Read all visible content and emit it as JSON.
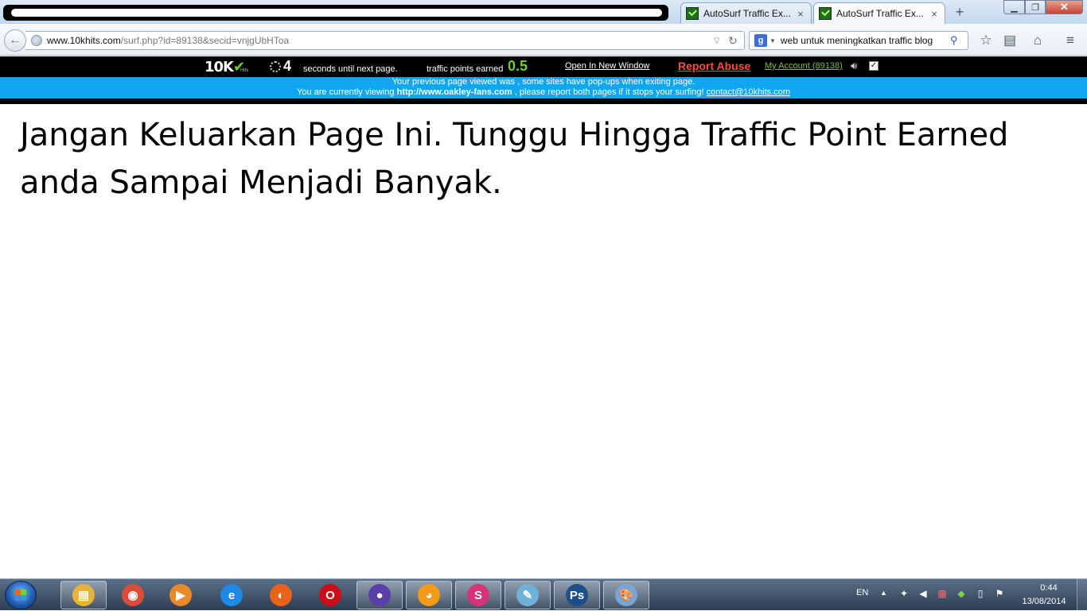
{
  "browser": {
    "tabs": [
      {
        "label": "AutoSurf Traffic Ex...",
        "close": "×"
      },
      {
        "label": "AutoSurf Traffic Ex...",
        "close": "×"
      }
    ],
    "new_tab": "+",
    "window_controls": {
      "minimize": "▁",
      "maximize": "❐",
      "close": "✕"
    },
    "nav": {
      "url_domain": "www.10khits.com",
      "url_path": "/surf.php?id=89138&secid=vnjgUbHToa",
      "search_engine": "g",
      "search_query": "web untuk meningkatkan traffic blog",
      "icons": {
        "back": "back-arrow-icon",
        "star": "star-icon",
        "reader": "reading-list-icon",
        "home": "home-icon",
        "menu": "menu-icon"
      }
    }
  },
  "surfbar": {
    "logo": "10K",
    "logo_check": "✔",
    "logo_sub": "Hits",
    "countdown": "4",
    "countdown_label": "seconds until next page.",
    "points_label": "traffic points earned",
    "points_value": "0.5",
    "open_new_window": "Open In New Window",
    "report_abuse": "Report Abuse",
    "my_account": "My Account (89138)",
    "checkbox": "✓"
  },
  "infobar": {
    "line1": "Your previous page viewed was , some sites have pop-ups when exiting page.",
    "line2_prefix": "You are currently viewing",
    "line2_url": "http://www.oakley-fans.com",
    "line2_middle": ", please report both pages if it stops your surfing!",
    "line2_email": "contact@10khits.com"
  },
  "page": {
    "heading": "Jangan Keluarkan Page Ini. Tunggu Hingga Traffic Point Earned anda Sampai Menjadi Banyak."
  },
  "taskbar": {
    "apps": [
      {
        "name": "windows-explorer",
        "glyph": "▤",
        "color": "#e8b33a"
      },
      {
        "name": "chrome",
        "glyph": "◉",
        "color": "#dd4b39"
      },
      {
        "name": "media-player",
        "glyph": "▶",
        "color": "#e88a2a"
      },
      {
        "name": "internet-explorer",
        "glyph": "e",
        "color": "#1e88e5"
      },
      {
        "name": "firefox",
        "glyph": "◐",
        "color": "#e8641c"
      },
      {
        "name": "opera",
        "glyph": "O",
        "color": "#cc0f16"
      },
      {
        "name": "firefox-active",
        "glyph": "●",
        "color": "#5b3fa8"
      },
      {
        "name": "app-orange",
        "glyph": "◕",
        "color": "#f29a1a"
      },
      {
        "name": "app-pink",
        "glyph": "S",
        "color": "#d6337a"
      },
      {
        "name": "app-notes",
        "glyph": "✎",
        "color": "#6fb1d8"
      },
      {
        "name": "photoshop",
        "glyph": "Ps",
        "color": "#1b4f8a"
      },
      {
        "name": "paint",
        "glyph": "🎨",
        "color": "#7aa5d6"
      }
    ],
    "tray": {
      "lang": "EN",
      "up": "▲",
      "time": "0:44",
      "date": "13/08/2014"
    }
  },
  "colors": {
    "surfbar_bg": "#000000",
    "infobar_bg": "#10a7f0",
    "points_green": "#6ccf2c",
    "report_red": "#ff4b3a"
  }
}
